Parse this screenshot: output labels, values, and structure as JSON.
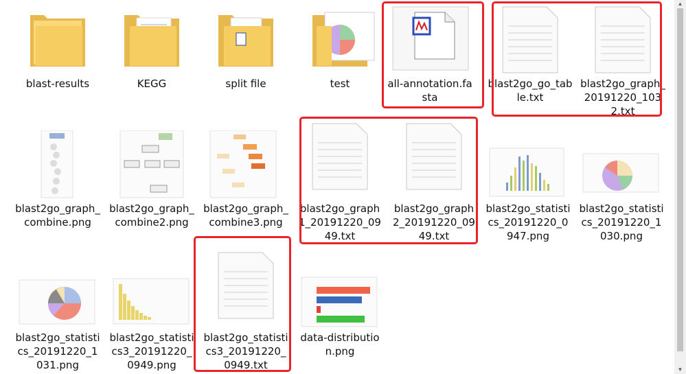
{
  "files": [
    {
      "name": "blast-results",
      "type": "folder"
    },
    {
      "name": "KEGG",
      "type": "folder"
    },
    {
      "name": "split file",
      "type": "folder"
    },
    {
      "name": "test",
      "type": "folder"
    },
    {
      "name": "all-annotation.fasta",
      "type": "fasta"
    },
    {
      "name": "blast2go_go_table.txt",
      "type": "txt"
    },
    {
      "name": "blast2go_graph_20191220_1032.txt",
      "type": "txt"
    },
    {
      "name": "blast2go_graph_combine.png",
      "type": "png"
    },
    {
      "name": "blast2go_graph_combine2.png",
      "type": "png"
    },
    {
      "name": "blast2go_graph_combine3.png",
      "type": "png"
    },
    {
      "name": "blast2go_graph1_20191220_0949.txt",
      "type": "txt"
    },
    {
      "name": "blast2go_graph2_20191220_0949.txt",
      "type": "txt"
    },
    {
      "name": "blast2go_statistics_20191220_0947.png",
      "type": "png"
    },
    {
      "name": "blast2go_statistics_20191220_1030.png",
      "type": "png"
    },
    {
      "name": "blast2go_statistics_20191220_1031.png",
      "type": "png"
    },
    {
      "name": "blast2go_statistics3_20191220_0949.png",
      "type": "png"
    },
    {
      "name": "blast2go_statistics3_20191220_0949.txt",
      "type": "txt"
    },
    {
      "name": "data-distribution.png",
      "type": "png"
    }
  ],
  "highlight_color": "#e8232a"
}
